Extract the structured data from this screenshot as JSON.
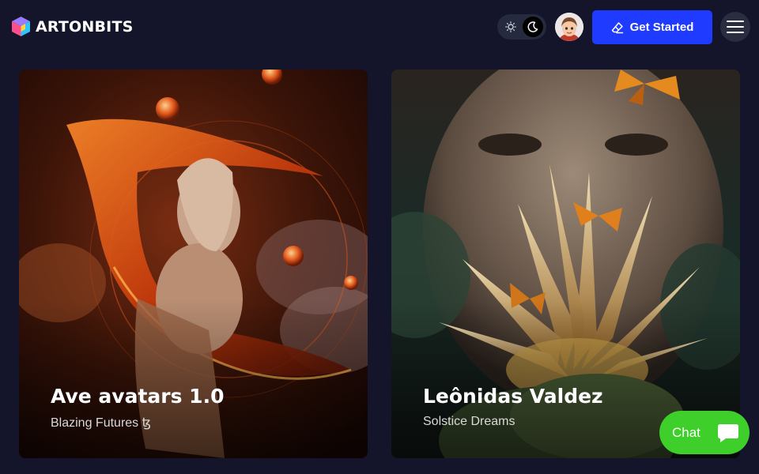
{
  "brand": {
    "name": "ARTONBITS"
  },
  "header": {
    "get_started_label": "Get Started",
    "theme_icons": [
      "sun-icon",
      "moon-icon"
    ],
    "accent_color": "#1f3bff"
  },
  "cards": [
    {
      "title": "Ave avatars 1.0",
      "subtitle": "Blazing Futures ꜩ"
    },
    {
      "title": "Leônidas Valdez",
      "subtitle": "Solstice Dreams"
    }
  ],
  "chat": {
    "label": "Chat",
    "color": "#3fcf2a"
  }
}
